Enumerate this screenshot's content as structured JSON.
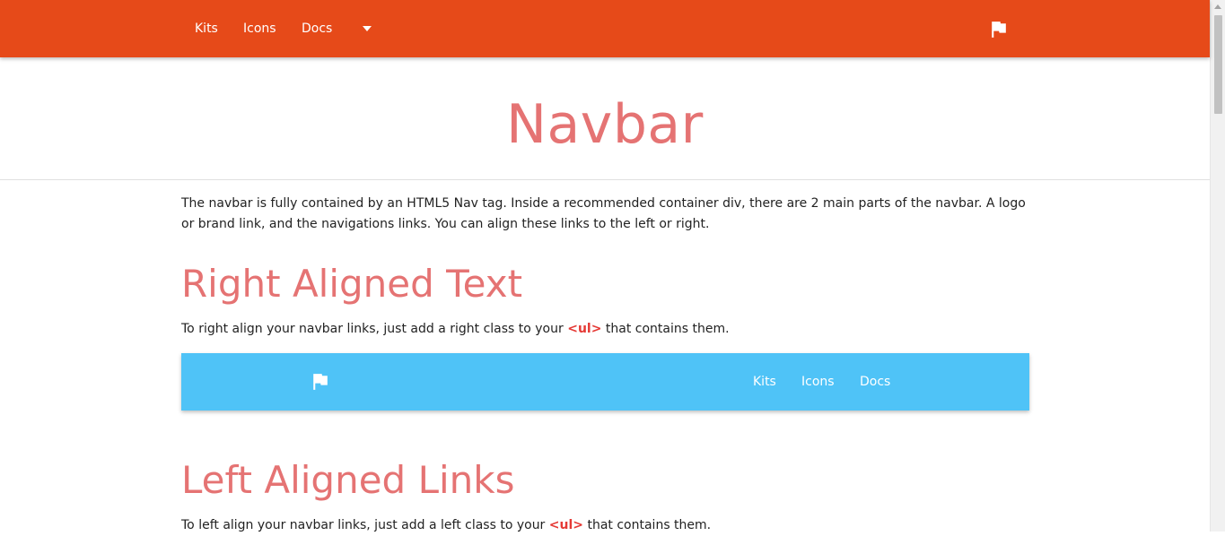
{
  "top_nav": {
    "links": [
      "Kits",
      "Icons",
      "Docs"
    ],
    "dropdown_icon": "caret-down-icon",
    "brand_icon": "flag-icon",
    "color": "#e64a19"
  },
  "header": {
    "title": "Navbar"
  },
  "intro": {
    "text": "The navbar is fully contained by an HTML5 Nav tag. Inside a recommended container div, there are 2 main parts of the navbar. A logo or brand link, and the navigations links. You can align these links to the left or right."
  },
  "right_section": {
    "heading": "Right Aligned Text",
    "text_before": "To right align your navbar links, just add a right class to your ",
    "code": "<ul>",
    "text_after": " that contains them.",
    "demo_nav": {
      "brand_icon": "flag-icon",
      "links": [
        "Kits",
        "Icons",
        "Docs"
      ],
      "color": "#4fc3f7"
    }
  },
  "left_section": {
    "heading": "Left Aligned Links",
    "text_before": "To left align your navbar links, just add a left class to your ",
    "code": "<ul>",
    "text_after": " that contains them."
  },
  "colors": {
    "heading": "#e57373",
    "code": "#e53935"
  }
}
